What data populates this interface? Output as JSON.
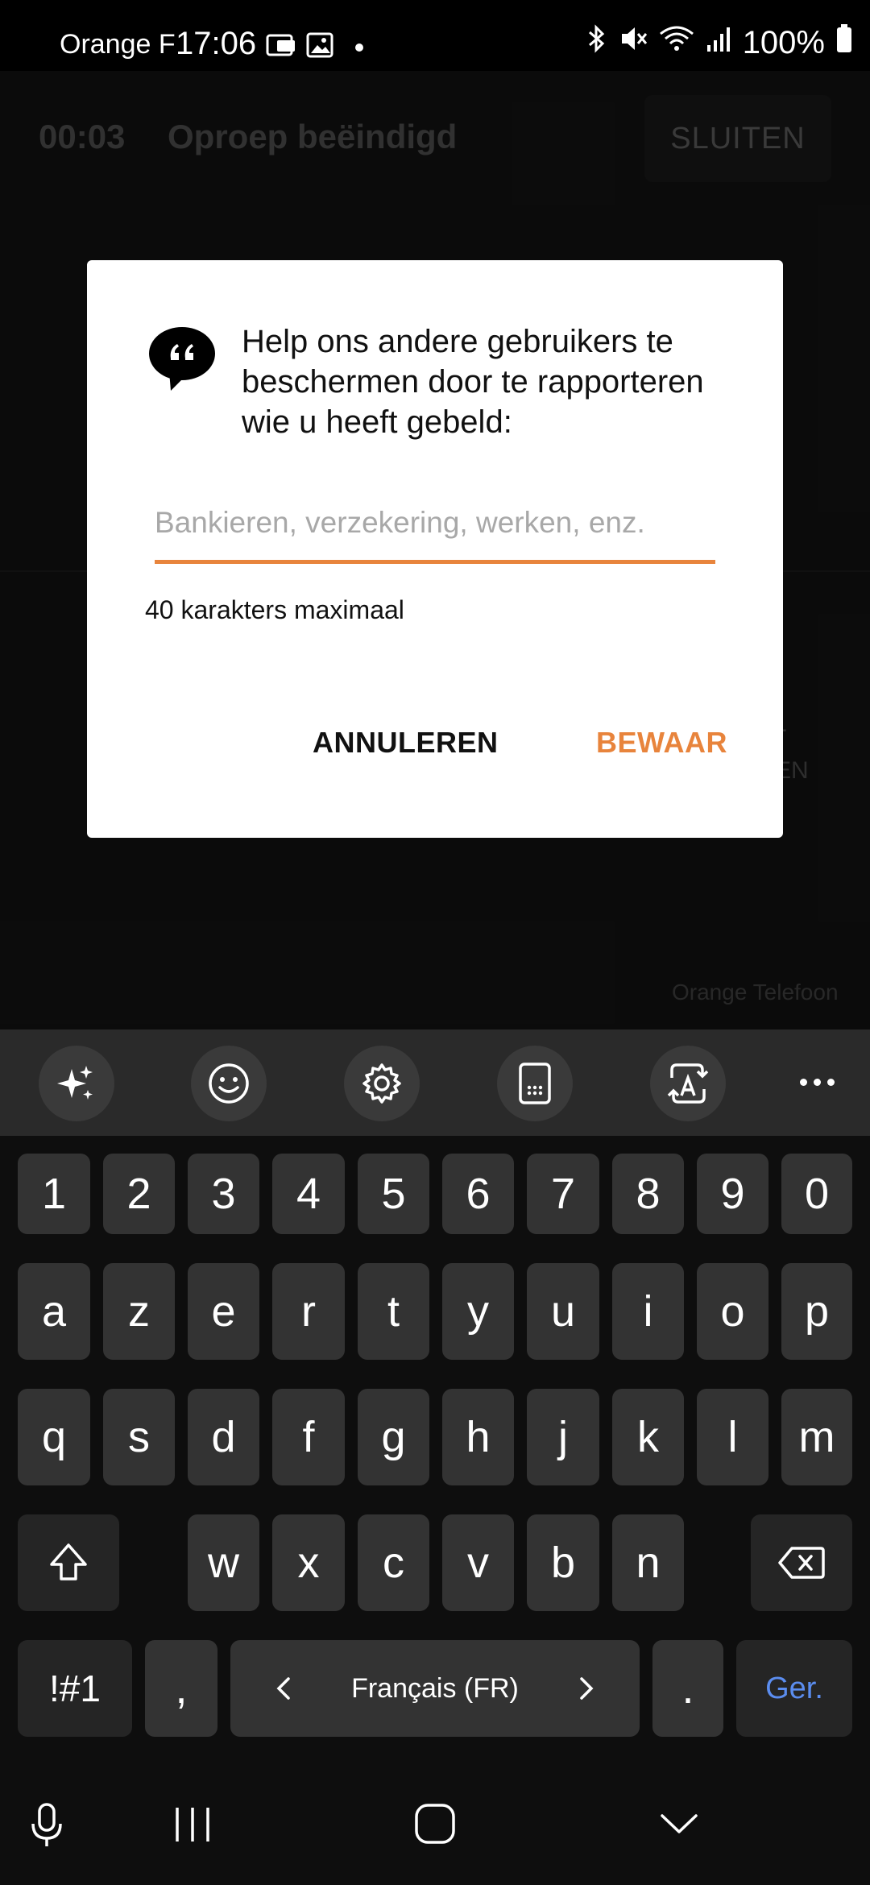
{
  "status_bar": {
    "carrier": "Orange F",
    "time": "17:06",
    "battery": "100%"
  },
  "call": {
    "timer": "00:03",
    "status": "Oproep beëindigd",
    "close_label": "SLUITEN",
    "partial_label_1": "T",
    "partial_label_2": "EN",
    "footer": "Orange Telefoon"
  },
  "dialog": {
    "message": "Help ons andere gebruikers te beschermen door te rapporteren wie u heeft gebeld:",
    "input_value": "",
    "input_placeholder": "Bankieren, verzekering, werken, enz.",
    "hint": "40 karakters maximaal",
    "cancel_label": "ANNULEREN",
    "save_label": "BEWAAR",
    "accent_color": "#E8843C"
  },
  "keyboard": {
    "toolbar_icons": [
      "sparkle-icon",
      "emoji-icon",
      "settings-icon",
      "keypad-icon",
      "translate-icon",
      "more-icon"
    ],
    "row_numbers": [
      "1",
      "2",
      "3",
      "4",
      "5",
      "6",
      "7",
      "8",
      "9",
      "0"
    ],
    "row1": [
      "a",
      "z",
      "e",
      "r",
      "t",
      "y",
      "u",
      "i",
      "o",
      "p"
    ],
    "row2": [
      "q",
      "s",
      "d",
      "f",
      "g",
      "h",
      "j",
      "k",
      "l",
      "m"
    ],
    "row3": [
      "w",
      "x",
      "c",
      "v",
      "b",
      "n"
    ],
    "symbols_label": "!#1",
    "comma_label": ",",
    "language_label": "Français (FR)",
    "period_label": ".",
    "enter_label": "Ger.",
    "enter_color": "#5B8DEF"
  }
}
